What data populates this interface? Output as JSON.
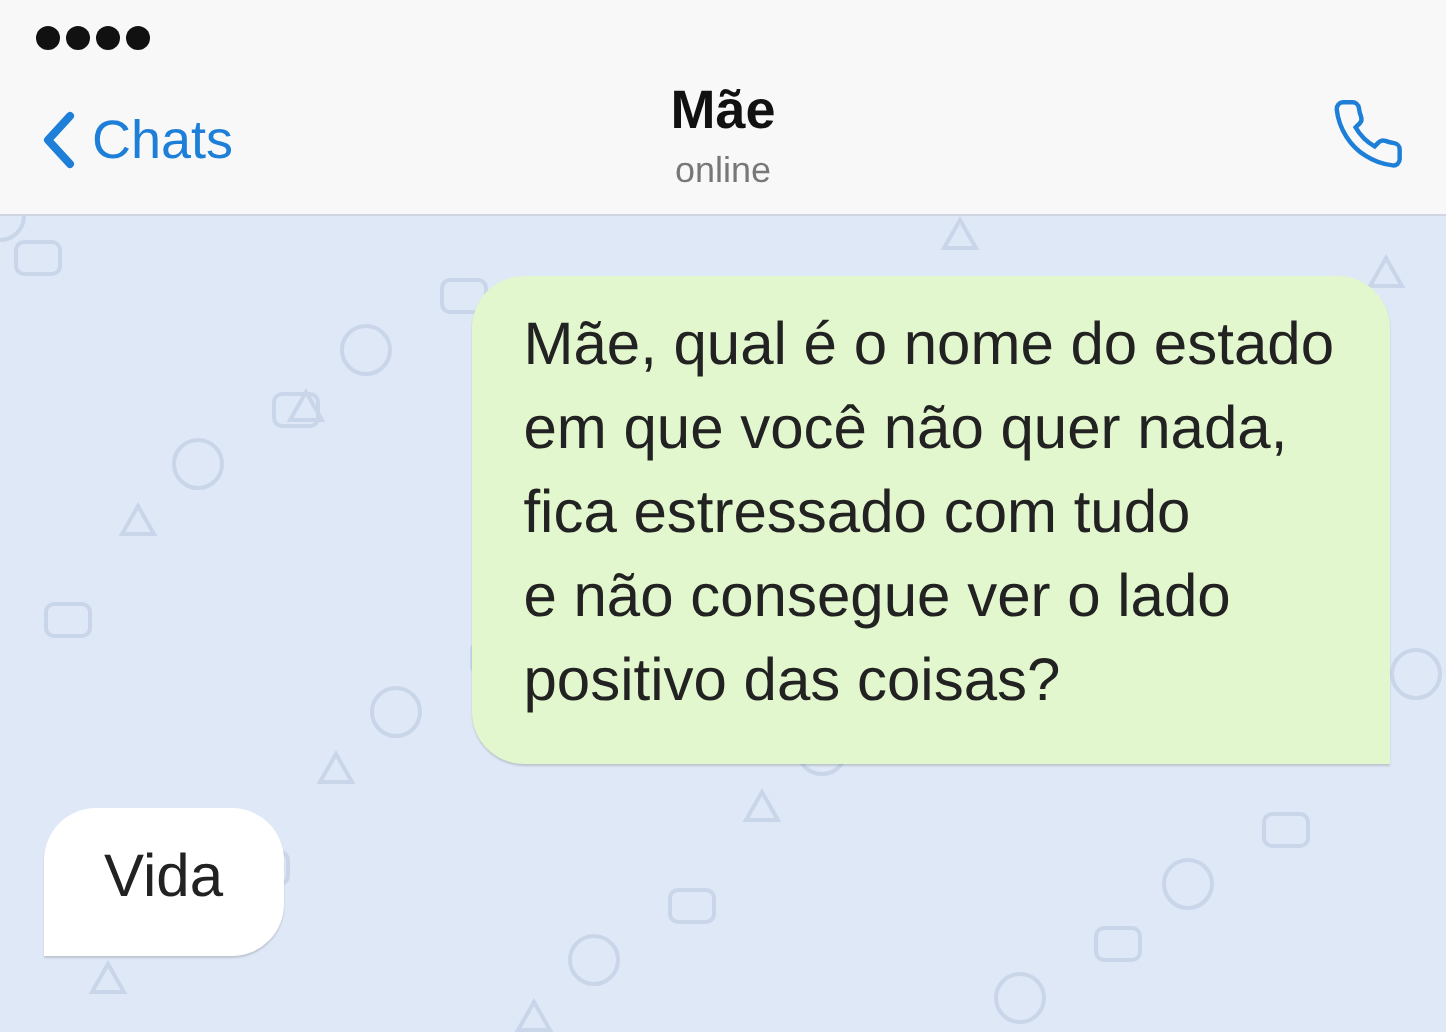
{
  "header": {
    "back_label": "Chats",
    "title": "Mãe",
    "subtitle": "online"
  },
  "messages": [
    {
      "kind": "outgoing",
      "text": "Mãe, qual é o nome do estado\nem que você não quer nada,\nfica estressado com tudo\ne não consegue ver o lado\npositivo das coisas?"
    },
    {
      "kind": "incoming",
      "text": "Vida"
    }
  ]
}
